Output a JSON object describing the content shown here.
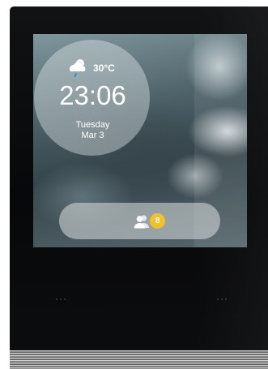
{
  "weather": {
    "temperature": "30°C",
    "icon": "cloudy-rain-icon"
  },
  "clock": {
    "time": "23:06",
    "day": "Tuesday",
    "date": "Mar 3"
  },
  "visitors": {
    "icon": "visitors-icon",
    "count": "8",
    "badge_color": "#f2c12a"
  },
  "touch_keys": {
    "left_icon": "menu-dots-icon",
    "right_icon": "menu-dots-icon"
  }
}
